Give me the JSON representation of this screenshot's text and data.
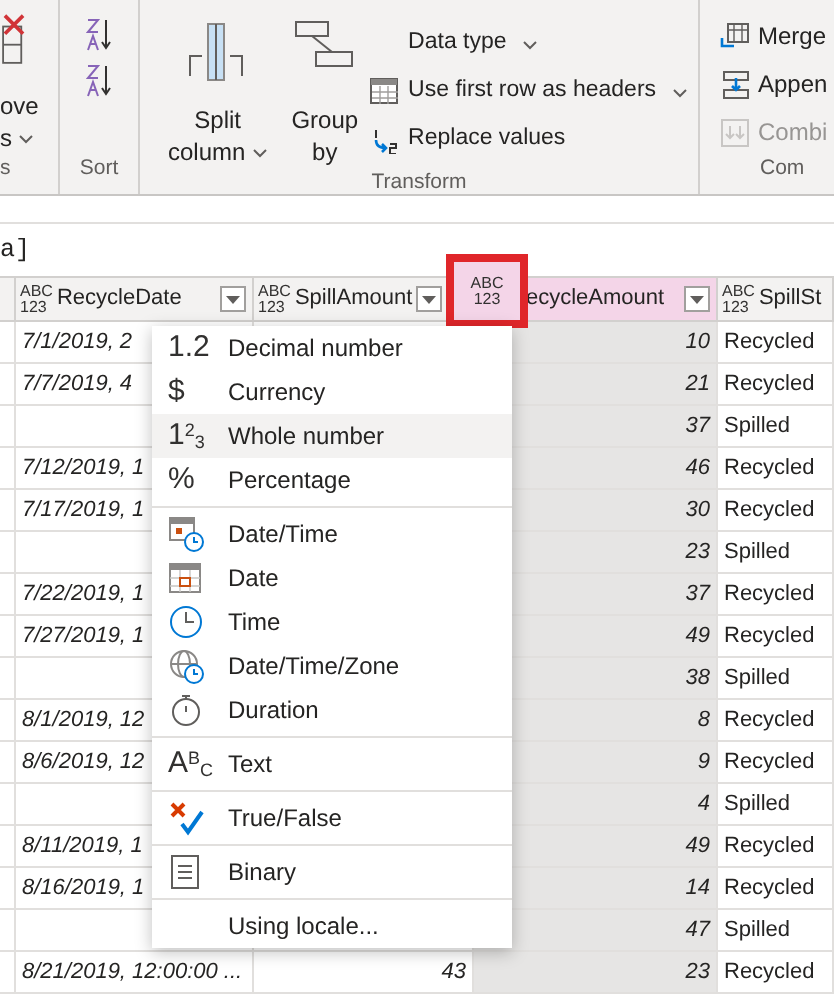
{
  "ribbon": {
    "partial_group": {
      "lines": [
        "ove",
        "s"
      ],
      "dropdown": true,
      "label": "s"
    },
    "sort_group": {
      "label": "Sort"
    },
    "transform_group": {
      "label": "Transform",
      "large_buttons": [
        {
          "kind": "split",
          "lines": [
            "Split",
            "column"
          ],
          "dropdown": true
        },
        {
          "kind": "group",
          "lines": [
            "Group",
            "by"
          ],
          "dropdown": false
        }
      ],
      "small_buttons": [
        {
          "kind": "none",
          "label": "Data type",
          "dropdown": true
        },
        {
          "kind": "table",
          "label": "Use first row as headers",
          "dropdown": true
        },
        {
          "kind": "replace",
          "label": "Replace values",
          "dropdown": false
        }
      ]
    },
    "combine_group": {
      "label": "Com",
      "buttons": [
        {
          "kind": "merge",
          "label": "Merge",
          "disabled": false
        },
        {
          "kind": "append",
          "label": "Appen",
          "disabled": false
        },
        {
          "kind": "combine",
          "label": "Combi",
          "disabled": true
        }
      ]
    }
  },
  "formula_bar": {
    "text": "a]"
  },
  "table": {
    "columns": [
      {
        "type_icon": [
          "ABC",
          "123"
        ],
        "label": "RecycleDate",
        "selected": false,
        "outlined": false
      },
      {
        "type_icon": [
          "ABC",
          "123"
        ],
        "label": "SpillAmount",
        "selected": false,
        "outlined": false
      },
      {
        "type_icon": [
          "ABC",
          "123"
        ],
        "label": "ecycleAmount",
        "selected": true,
        "outlined": true
      },
      {
        "type_icon": [
          "ABC",
          "123"
        ],
        "label": "SpillSt",
        "selected": false,
        "outlined": false
      }
    ],
    "rows": [
      {
        "recycle_date": "7/1/2019, 2",
        "recycle_amount": "10",
        "spill_status": "Recycled"
      },
      {
        "recycle_date": "7/7/2019, 4",
        "recycle_amount": "21",
        "spill_status": "Recycled"
      },
      {
        "recycle_amount": "37",
        "spill_status": "Spilled"
      },
      {
        "recycle_date": "7/12/2019, 1",
        "recycle_amount": "46",
        "spill_status": "Recycled"
      },
      {
        "recycle_date": "7/17/2019, 1",
        "recycle_amount": "30",
        "spill_status": "Recycled"
      },
      {
        "recycle_amount": "23",
        "spill_status": "Spilled"
      },
      {
        "recycle_date": "7/22/2019, 1",
        "recycle_amount": "37",
        "spill_status": "Recycled"
      },
      {
        "recycle_date": "7/27/2019, 1",
        "recycle_amount": "49",
        "spill_status": "Recycled"
      },
      {
        "recycle_amount": "38",
        "spill_status": "Spilled"
      },
      {
        "recycle_date": "8/1/2019, 12",
        "recycle_amount": "8",
        "spill_status": "Recycled"
      },
      {
        "recycle_date": "8/6/2019, 12",
        "recycle_amount": "9",
        "spill_status": "Recycled"
      },
      {
        "recycle_amount": "4",
        "spill_status": "Spilled"
      },
      {
        "recycle_date": "8/11/2019, 1",
        "recycle_amount": "49",
        "spill_status": "Recycled"
      },
      {
        "recycle_date": "8/16/2019, 1",
        "recycle_amount": "14",
        "spill_status": "Recycled"
      },
      {
        "recycle_amount": "47",
        "spill_status": "Spilled"
      },
      {
        "recycle_date": "8/21/2019, 12:00:00 ...",
        "spill_amount": "43",
        "recycle_amount": "23",
        "spill_status": "Recycled"
      }
    ]
  },
  "type_menu": {
    "items": [
      {
        "icon": {
          "kind": "glyph",
          "text": "1.2"
        },
        "label": "Decimal number",
        "highlighted": false,
        "separator_before": false
      },
      {
        "icon": {
          "kind": "glyph",
          "text": "$"
        },
        "label": "Currency",
        "highlighted": false,
        "separator_before": false
      },
      {
        "icon": {
          "kind": "glyph",
          "text": "1$^{2}$$_{3}$"
        },
        "label": "Whole number",
        "highlighted": true,
        "separator_before": false
      },
      {
        "icon": {
          "kind": "glyph",
          "text": "%"
        },
        "label": "Percentage",
        "highlighted": false,
        "separator_before": false
      },
      {
        "icon": {
          "kind": "datetime"
        },
        "label": "Date/Time",
        "highlighted": false,
        "separator_before": true
      },
      {
        "icon": {
          "kind": "date"
        },
        "label": "Date",
        "highlighted": false,
        "separator_before": false
      },
      {
        "icon": {
          "kind": "time"
        },
        "label": "Time",
        "highlighted": false,
        "separator_before": false
      },
      {
        "icon": {
          "kind": "zone"
        },
        "label": "Date/Time/Zone",
        "highlighted": false,
        "separator_before": false
      },
      {
        "icon": {
          "kind": "duration"
        },
        "label": "Duration",
        "highlighted": false,
        "separator_before": false
      },
      {
        "icon": {
          "kind": "glyph",
          "text": "A$^{B}$$_{C}$"
        },
        "label": "Text",
        "highlighted": false,
        "separator_before": true
      },
      {
        "icon": {
          "kind": "truefalse"
        },
        "label": "True/False",
        "highlighted": false,
        "separator_before": true
      },
      {
        "icon": {
          "kind": "binary"
        },
        "label": "Binary",
        "highlighted": false,
        "separator_before": true
      },
      {
        "icon": {
          "kind": "none"
        },
        "label": "Using locale...",
        "highlighted": false,
        "separator_before": true
      }
    ]
  }
}
